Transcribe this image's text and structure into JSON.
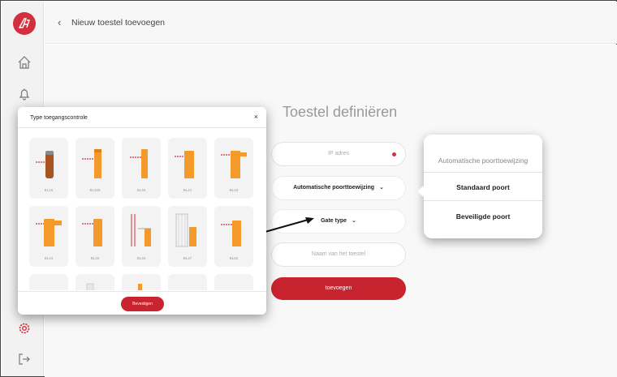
{
  "header": {
    "back_icon": "chevron-left-icon",
    "title": "Nieuw toestel toevoegen"
  },
  "sidebar": {
    "logo": "AS-logo",
    "icons": [
      "home-icon",
      "bell-icon",
      "gear-icon",
      "logout-icon"
    ]
  },
  "main": {
    "page_title": "Toestel definiëren",
    "ip_placeholder": "IP adres",
    "port_select": "Automatische poorttoewijzing",
    "gate_select": "Gate type",
    "name_placeholder": "Naam van het toestel",
    "submit_label": "toevoegen"
  },
  "port_dropdown": {
    "options": [
      "Automatische poorttoewijzing",
      "Standaard poort",
      "Beveiligde poort"
    ]
  },
  "modal": {
    "title": "Type toegangscontrole",
    "close": "×",
    "tiles": [
      "BL15",
      "BL229",
      "BL40",
      "BL41",
      "BL43",
      "BL44",
      "BL45",
      "BL46",
      "BL47",
      "BL52",
      "",
      "",
      "",
      "",
      ""
    ],
    "confirm_label": "Bevestigen"
  },
  "colors": {
    "accent": "#c8242f",
    "orange": "#f39a2a"
  }
}
